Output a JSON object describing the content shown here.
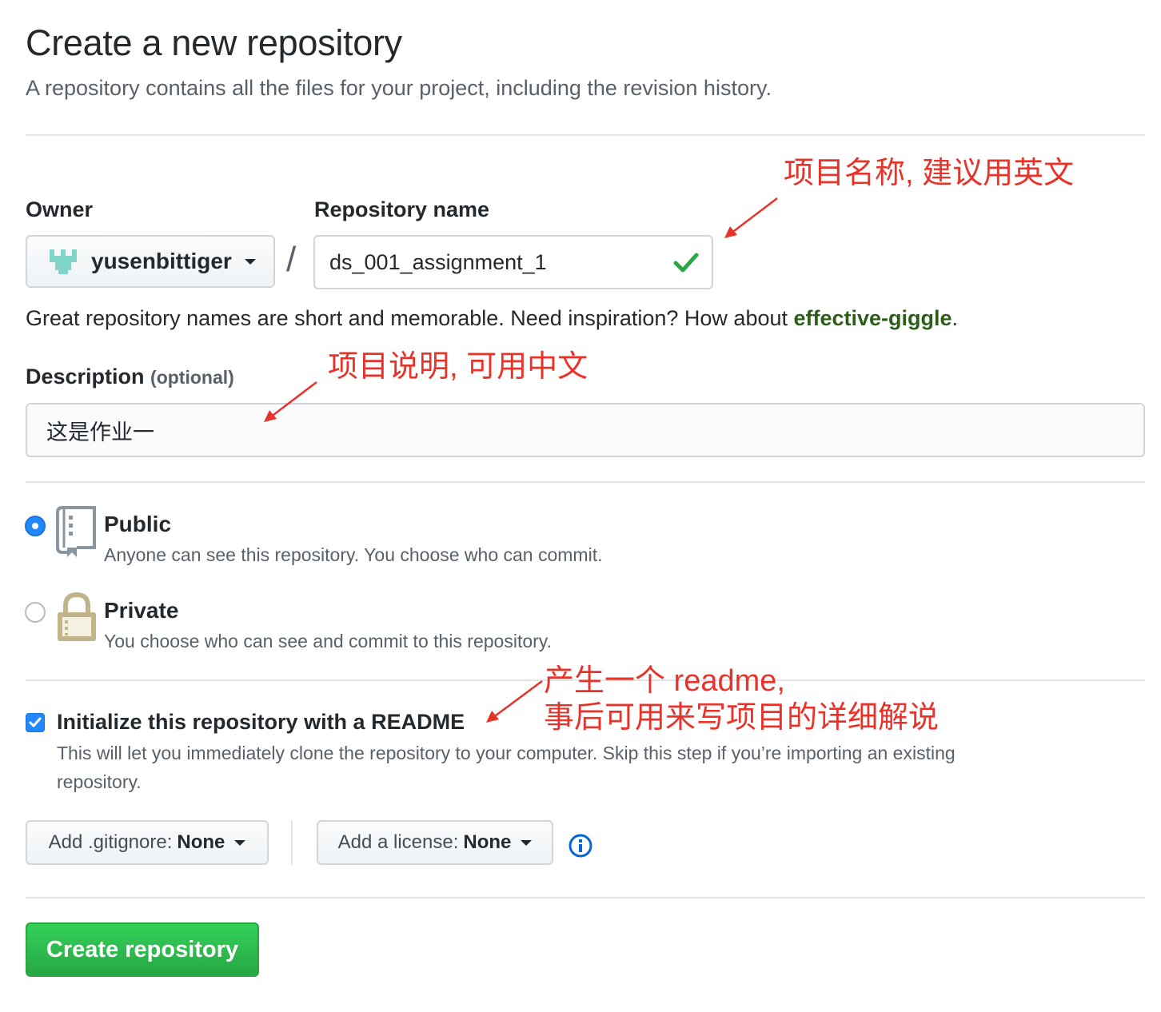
{
  "header": {
    "title": "Create a new repository",
    "subtitle": "A repository contains all the files for your project, including the revision history."
  },
  "owner": {
    "label": "Owner",
    "name": "yusenbittiger"
  },
  "separator": "/",
  "repo": {
    "label": "Repository name",
    "value": "ds_001_assignment_1"
  },
  "hint": {
    "text": "Great repository names are short and memorable. Need inspiration? How about ",
    "suggestion": "effective-giggle",
    "end": "."
  },
  "description": {
    "label": "Description",
    "optional": "(optional)",
    "value": "这是作业一"
  },
  "visibility": {
    "public_title": "Public",
    "public_note": "Anyone can see this repository. You choose who can commit.",
    "private_title": "Private",
    "private_note": "You choose who can see and commit to this repository."
  },
  "readme": {
    "title": "Initialize this repository with a README",
    "note_line1": "This will let you immediately clone the repository to your computer. Skip this step if you’re importing an existing",
    "note_line2": "repository."
  },
  "gitignore": {
    "key": "Add .gitignore:",
    "value": "None"
  },
  "license": {
    "key": "Add a license:",
    "value": "None"
  },
  "create_button": "Create repository",
  "annotations": {
    "repo_name": "项目名称, 建议用英文",
    "description": "项目说明, 可用中文",
    "readme_line1": "产生一个 readme,",
    "readme_line2": "事后可用来写项目的详细解说"
  },
  "colors": {
    "accent_blue": "#2188ff",
    "success_green": "#28a745",
    "annotation_red": "#e8332a",
    "suggestion_green": "#2c5e1a"
  },
  "icons": [
    "owner-avatar-icon",
    "checkmark-icon",
    "repo-book-icon",
    "lock-icon",
    "info-icon",
    "caret-down-icon",
    "check-icon"
  ]
}
